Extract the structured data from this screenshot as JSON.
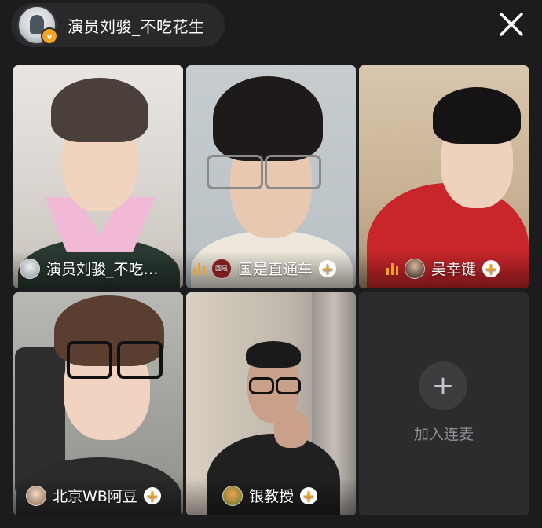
{
  "header": {
    "host_name": "演员刘骏_不吃花生",
    "verified_icon": "verified-v-icon",
    "close_icon": "close-icon"
  },
  "participants": [
    {
      "name": "演员刘骏_不吃…",
      "speaking": false,
      "follow": false
    },
    {
      "name": "国是直通车",
      "speaking": true,
      "follow": true,
      "avatar_text": "国是"
    },
    {
      "name": "吴幸键",
      "speaking": true,
      "follow": true
    },
    {
      "name": "北京WB阿豆",
      "speaking": false,
      "follow": true
    },
    {
      "name": "银教授",
      "speaking": false,
      "follow": true
    }
  ],
  "empty_slot": {
    "label": "加入连麦",
    "icon": "plus-icon"
  },
  "colors": {
    "background": "#1c1c1e",
    "accent_orange": "#f0a020",
    "empty_slot": "#2c2c2e"
  }
}
